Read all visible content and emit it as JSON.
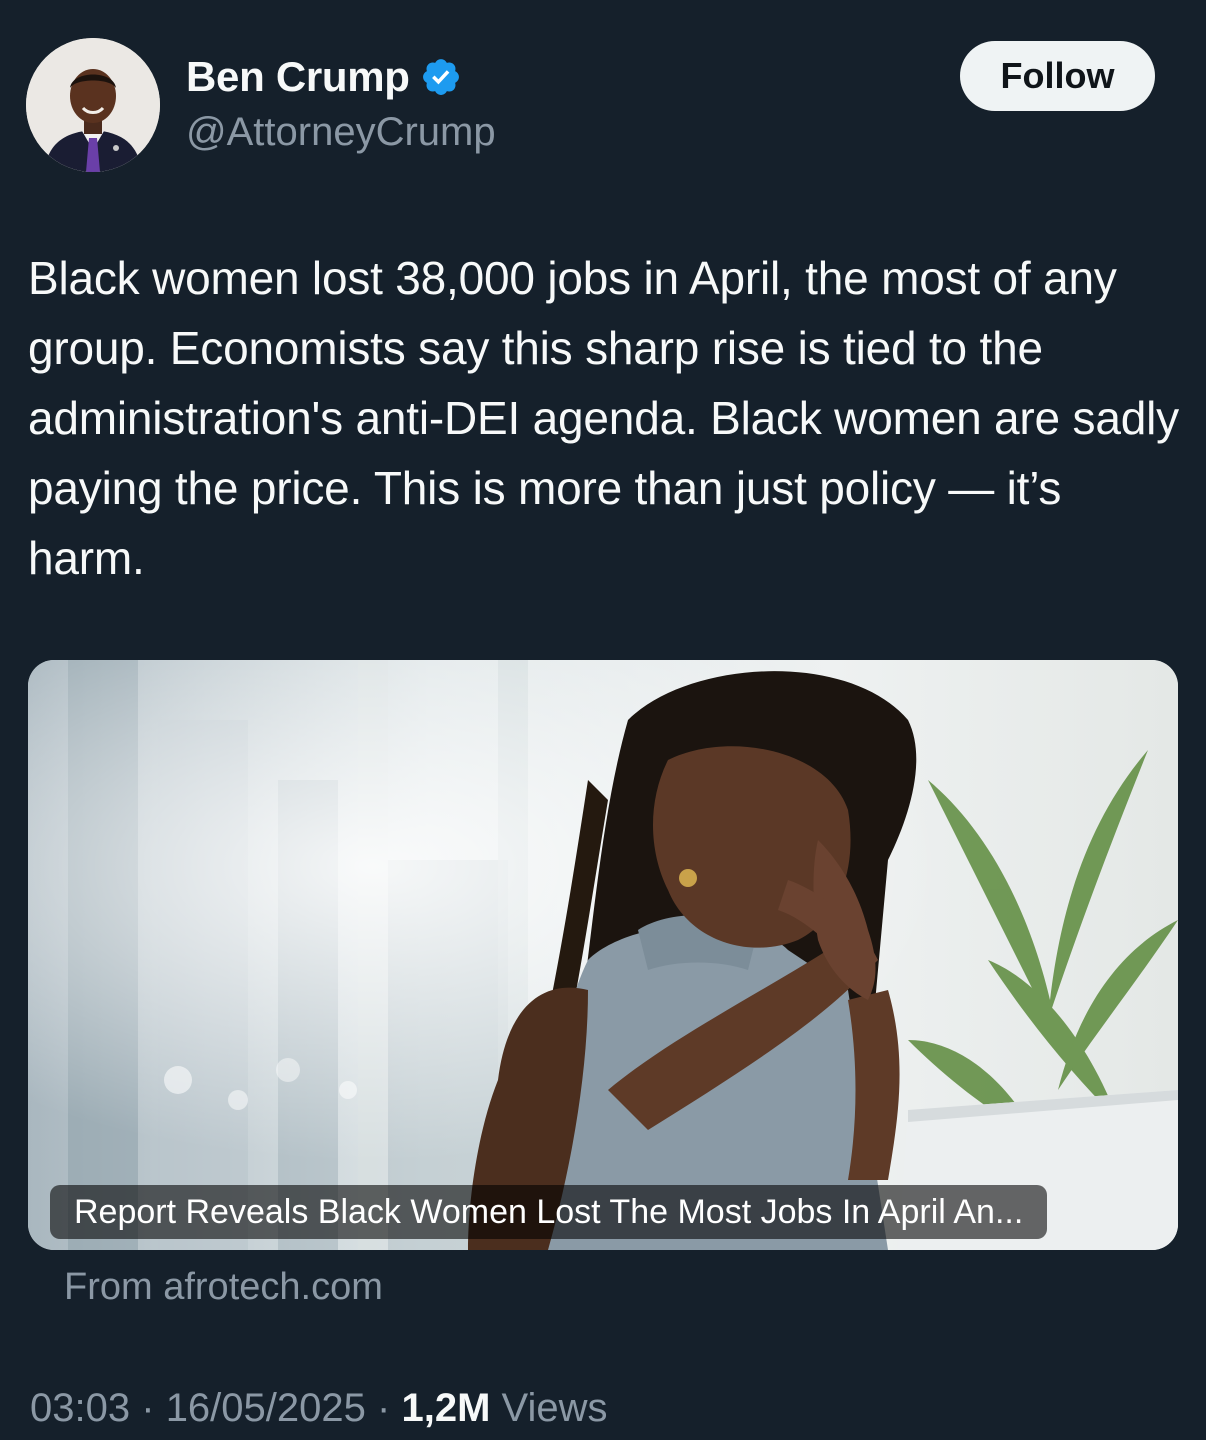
{
  "author": {
    "display_name": "Ben Crump",
    "handle": "@AttorneyCrump",
    "verified": true,
    "avatar_icon": "profile-photo",
    "verified_color": "#1d9bf0"
  },
  "follow_label": "Follow",
  "tweet": {
    "text": "Black women lost 38,000 jobs in April, the most of any group. Economists say this sharp rise is tied to the administration's anti-DEI agenda. Black women are sadly paying the price. This is more than just policy — it’s harm."
  },
  "card": {
    "headline": "Report Reveals Black Women Lost The Most Jobs In April An...",
    "source": "From afrotech.com"
  },
  "meta": {
    "time": "03:03",
    "separator": "·",
    "date": "16/05/2025",
    "views_count": "1,2M",
    "views_label": "Views"
  }
}
